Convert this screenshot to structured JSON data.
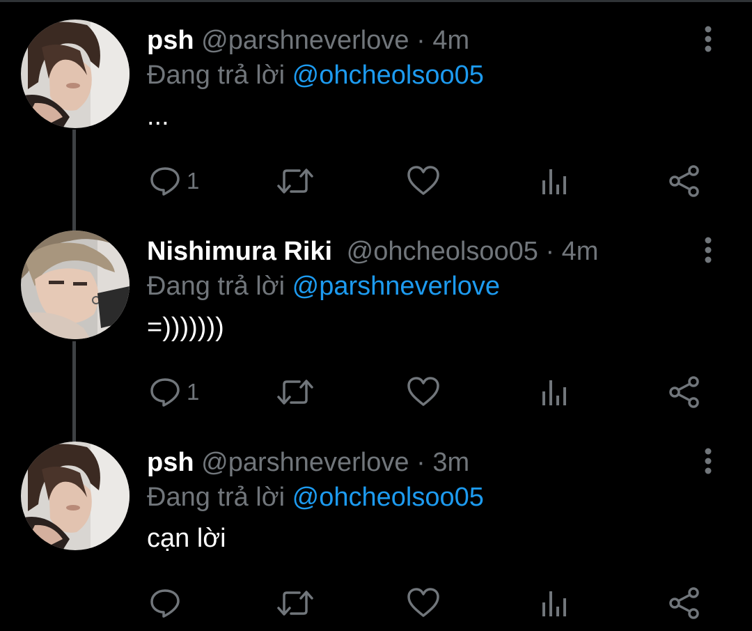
{
  "colors": {
    "background": "#000000",
    "text_primary": "#ffffff",
    "text_secondary": "#71767b",
    "link": "#1d9bf0",
    "thread_line": "#3e4144"
  },
  "tweets": [
    {
      "display_name": "psh",
      "handle": "@parshneverlove",
      "separator": "·",
      "time": "4m",
      "reply_prefix": "Đang trả lời",
      "reply_to": "@ohcheolsoo05",
      "text": "...",
      "reply_count": "1",
      "avatar": "avatar-psh",
      "icons": [
        "reply-icon",
        "retweet-icon",
        "like-icon",
        "views-icon",
        "share-icon",
        "more-icon"
      ]
    },
    {
      "display_name": "Nishimura Riki",
      "handle": "@ohcheolsoo05",
      "separator": "·",
      "time": "4m",
      "reply_prefix": "Đang trả lời",
      "reply_to": "@parshneverlove",
      "text": "=)))))))",
      "reply_count": "1",
      "avatar": "avatar-riki",
      "icons": [
        "reply-icon",
        "retweet-icon",
        "like-icon",
        "views-icon",
        "share-icon",
        "more-icon"
      ]
    },
    {
      "display_name": "psh",
      "handle": "@parshneverlove",
      "separator": "·",
      "time": "3m",
      "reply_prefix": "Đang trả lời",
      "reply_to": "@ohcheolsoo05",
      "text": "cạn lời",
      "reply_count": "",
      "avatar": "avatar-psh",
      "icons": [
        "reply-icon",
        "retweet-icon",
        "like-icon",
        "views-icon",
        "share-icon",
        "more-icon"
      ]
    }
  ]
}
